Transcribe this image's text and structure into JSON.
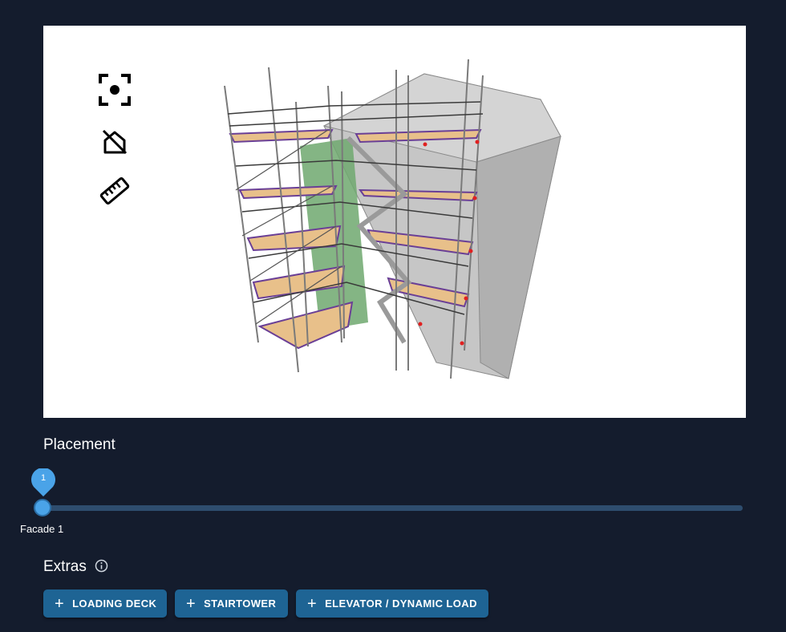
{
  "viewer": {
    "tools": [
      {
        "name": "focus-icon"
      },
      {
        "name": "hide-building-icon"
      },
      {
        "name": "ruler-icon"
      }
    ],
    "colors": {
      "building": "#bcbcbc",
      "wall": "#6fa86f",
      "deck": "#e8c08a",
      "toe_board": "#6a3f96",
      "tube": "#7a7a7a"
    }
  },
  "placement": {
    "title": "Placement",
    "value_label": "1",
    "mark_label": "Facade 1"
  },
  "extras": {
    "title": "Extras",
    "info_icon": "info-icon",
    "buttons": [
      {
        "label": "LOADING DECK"
      },
      {
        "label": "STAIRTOWER"
      },
      {
        "label": "ELEVATOR / DYNAMIC LOAD"
      }
    ]
  }
}
